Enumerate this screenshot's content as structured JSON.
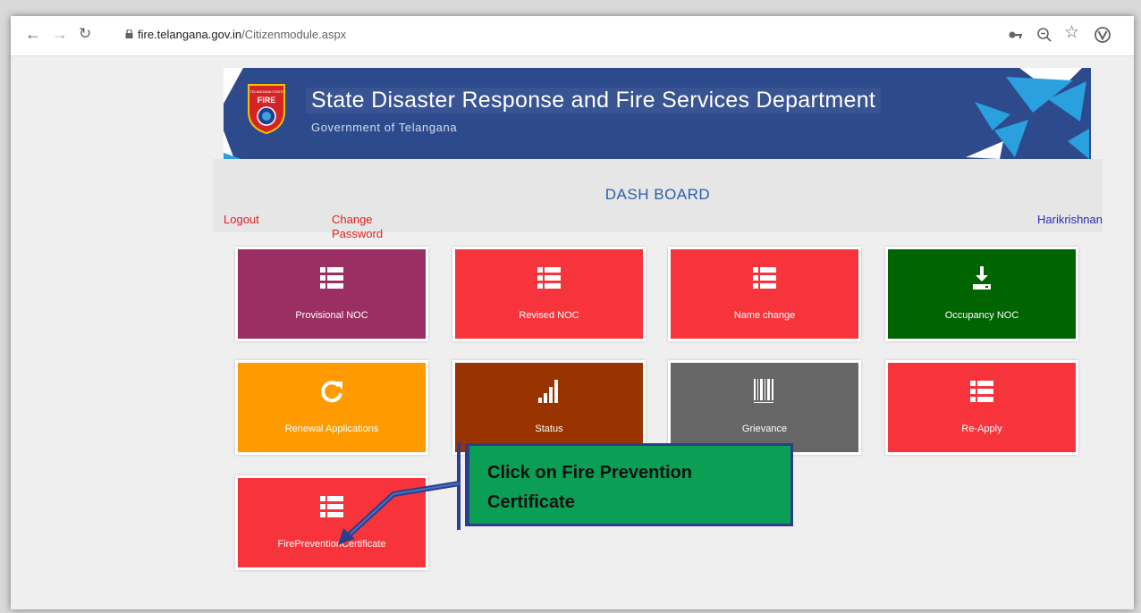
{
  "browser": {
    "back_icon": "arrow-left-icon",
    "forward_icon": "arrow-right-icon",
    "reload_icon": "reload-icon",
    "url_host": "fire.telangana.gov.in",
    "url_path": "/Citizenmodule.aspx",
    "key_icon": "key-icon",
    "zoom_icon": "zoom-icon",
    "star_icon": "star-icon",
    "extension_icon": "extension-icon"
  },
  "banner": {
    "title": "State Disaster Response and Fire Services Department",
    "subtitle": "Government of Telangana",
    "logo_text": "FIRE",
    "logo_ring_text": "TELANGANA STATE",
    "background_color": "#2d4a8d"
  },
  "header": {
    "title": "DASH BOARD",
    "logout": "Logout",
    "change_password_line1": "Change",
    "change_password_line2": "Password",
    "user": "Harikrishnan"
  },
  "tiles": [
    {
      "label": "Provisional NOC",
      "icon": "list-icon",
      "color": "#9b2f63"
    },
    {
      "label": "Revised NOC",
      "icon": "list-icon",
      "color": "#f7333b"
    },
    {
      "label": "Name change",
      "icon": "list-icon",
      "color": "#f7333b"
    },
    {
      "label": "Occupancy NOC",
      "icon": "download-icon",
      "color": "#006400"
    },
    {
      "label": "Renewal Applications",
      "icon": "refresh-icon",
      "color": "#ff9b00"
    },
    {
      "label": "Status",
      "icon": "signal-bars-icon",
      "color": "#993300"
    },
    {
      "label": "Grievance",
      "icon": "barcode-icon",
      "color": "#666666"
    },
    {
      "label": "Re-Apply",
      "icon": "list-icon",
      "color": "#f7333b"
    },
    {
      "label": "FirePreventionCertificate",
      "icon": "list-icon",
      "color": "#f7333b"
    }
  ],
  "callout": {
    "line1": "Click on Fire Prevention",
    "line2": "Certificate",
    "color": "#0a9f54",
    "arrow_color": "#2c3e8a"
  }
}
